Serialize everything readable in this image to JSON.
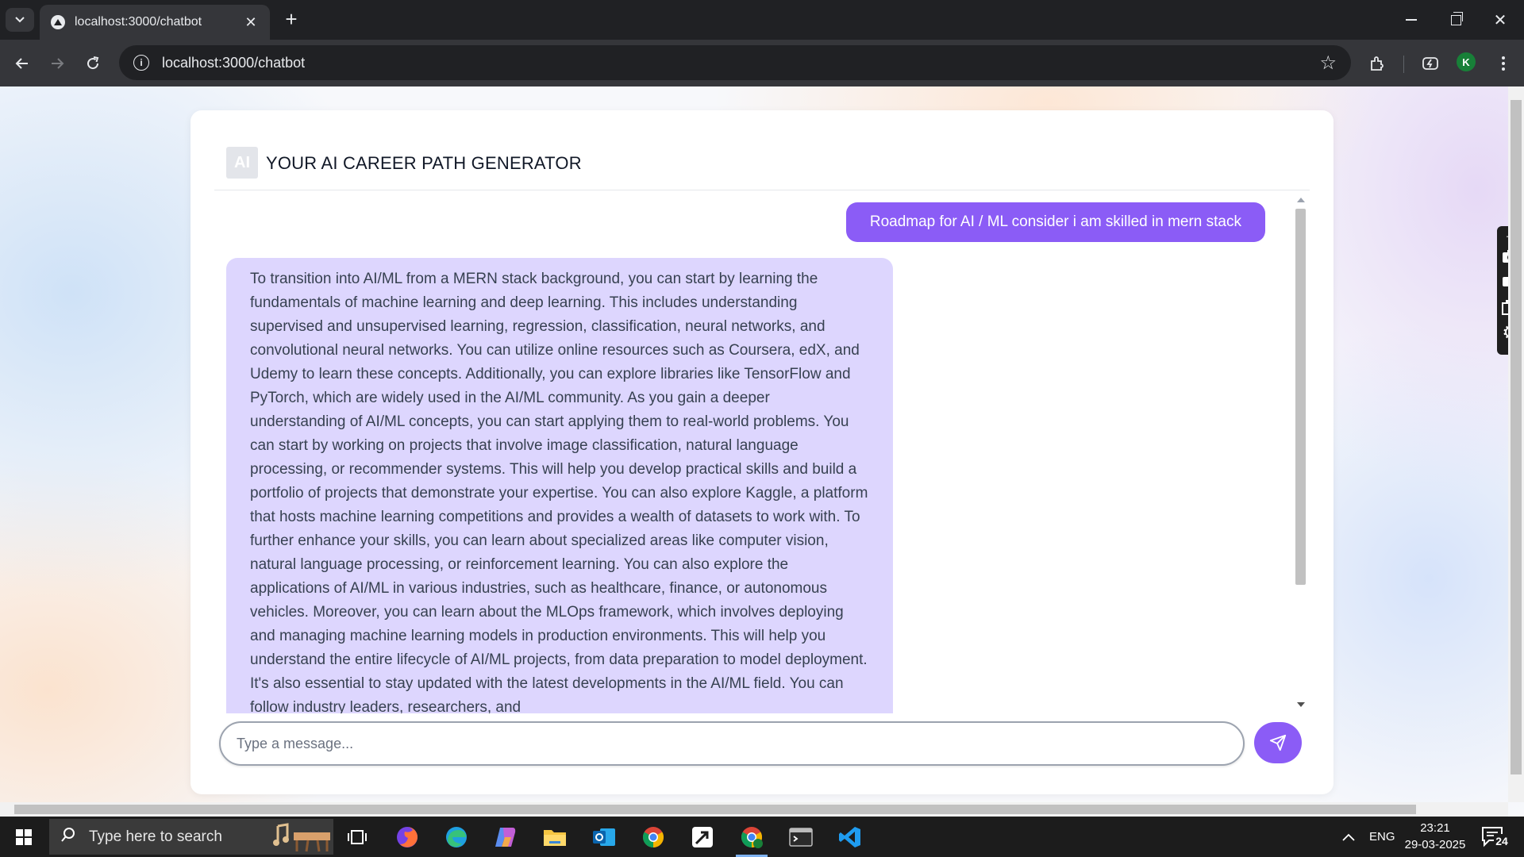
{
  "browser": {
    "tab_title": "localhost:3000/chatbot",
    "url": "localhost:3000/chatbot",
    "profile_initial": "K"
  },
  "chat": {
    "badge": "AI",
    "title": "YOUR AI CAREER PATH GENERATOR",
    "user_message": "Roadmap for AI / ML consider i am skilled in mern stack",
    "bot_message": "To transition into AI/ML from a MERN stack background, you can start by learning the fundamentals of machine learning and deep learning. This includes understanding supervised and unsupervised learning, regression, classification, neural networks, and convolutional neural networks. You can utilize online resources such as Coursera, edX, and Udemy to learn these concepts. Additionally, you can explore libraries like TensorFlow and PyTorch, which are widely used in the AI/ML community. As you gain a deeper understanding of AI/ML concepts, you can start applying them to real-world problems. You can start by working on projects that involve image classification, natural language processing, or recommender systems. This will help you develop practical skills and build a portfolio of projects that demonstrate your expertise. You can also explore Kaggle, a platform that hosts machine learning competitions and provides a wealth of datasets to work with. To further enhance your skills, you can learn about specialized areas like computer vision, natural language processing, or reinforcement learning. You can also explore the applications of AI/ML in various industries, such as healthcare, finance, or autonomous vehicles. Moreover, you can learn about the MLOps framework, which involves deploying and managing machine learning models in production environments. This will help you understand the entire lifecycle of AI/ML projects, from data preparation to model deployment. It's also essential to stay updated with the latest developments in the AI/ML field. You can follow industry leaders, researchers, and",
    "input_placeholder": "Type a message...",
    "input_value": ""
  },
  "taskbar": {
    "search_placeholder": "Type here to search",
    "language": "ENG",
    "time": "23:21",
    "date": "29-03-2025",
    "notification_count": "24"
  },
  "colors": {
    "accent": "#8b5cf6",
    "bot_bubble": "#ddd6fe",
    "chrome_dark": "#202124",
    "chrome_toolbar": "#35363a"
  }
}
